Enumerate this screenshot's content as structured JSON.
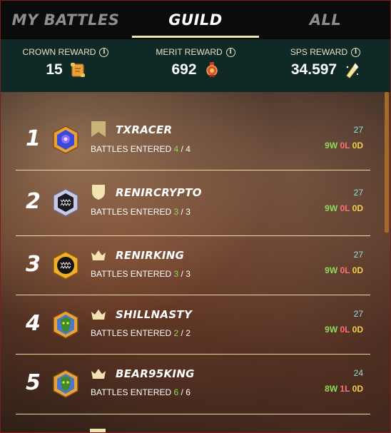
{
  "tabs": [
    {
      "label": "MY BATTLES",
      "active": false
    },
    {
      "label": "GUILD",
      "active": true
    },
    {
      "label": "ALL",
      "active": false
    }
  ],
  "rewards": {
    "crown": {
      "label": "CROWN REWARD",
      "value": "15",
      "icon": "crown-reward-scroll-icon"
    },
    "merit": {
      "label": "MERIT REWARD",
      "value": "692",
      "icon": "merit-medal-icon"
    },
    "sps": {
      "label": "SPS REWARD",
      "value": "34.597",
      "icon": "sps-crystal-icon"
    }
  },
  "colors": {
    "accent": "#f2e3b0",
    "win": "#8cdc5a",
    "loss": "#ff6f6f",
    "draw": "#f2cf4a",
    "score": "#8fe0e0",
    "reward_bg": "#0f2a26"
  },
  "players": [
    {
      "rank": "1",
      "name": "TXRACER",
      "badge": "banner-icon",
      "battles_label": "BATTLES ENTERED",
      "entered": "4",
      "total": "4",
      "score": "27",
      "wins": "9",
      "losses": "0",
      "draws": "0"
    },
    {
      "rank": "2",
      "name": "RENIRCRYPTO",
      "badge": "shield-icon",
      "battles_label": "BATTLES ENTERED",
      "entered": "3",
      "total": "3",
      "score": "27",
      "wins": "9",
      "losses": "0",
      "draws": "0"
    },
    {
      "rank": "3",
      "name": "RENIRKING",
      "badge": "crown-icon",
      "battles_label": "BATTLES ENTERED",
      "entered": "3",
      "total": "3",
      "score": "27",
      "wins": "9",
      "losses": "0",
      "draws": "0"
    },
    {
      "rank": "4",
      "name": "SHILLNASTY",
      "badge": "crown-icon",
      "battles_label": "BATTLES ENTERED",
      "entered": "2",
      "total": "2",
      "score": "27",
      "wins": "9",
      "losses": "0",
      "draws": "0"
    },
    {
      "rank": "5",
      "name": "BEAR95KING",
      "badge": "crown-icon",
      "battles_label": "BATTLES ENTERED",
      "entered": "6",
      "total": "6",
      "score": "24",
      "wins": "8",
      "losses": "1",
      "draws": "0"
    }
  ],
  "wld_letters": {
    "w": "W",
    "l": "L",
    "d": "D"
  }
}
